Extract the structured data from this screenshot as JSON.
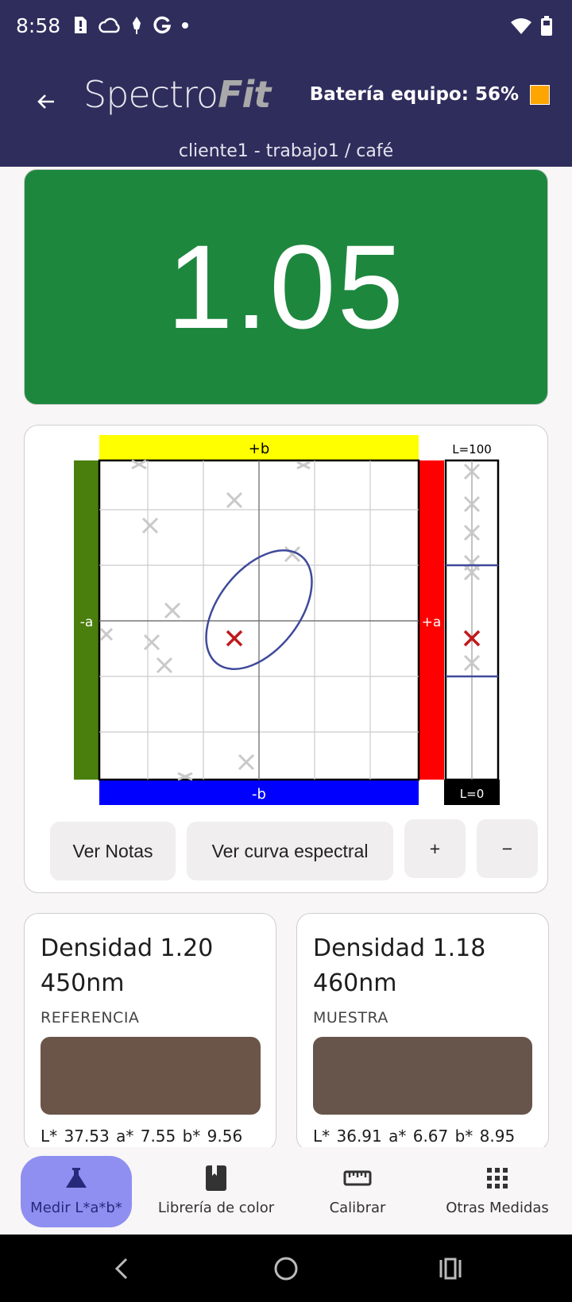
{
  "status_bar": {
    "time": "8:58"
  },
  "app_bar": {
    "logo_part1": "Spectro",
    "logo_part2": "Fit",
    "battery_text": "Batería equipo: 56%",
    "battery_color": "#ffa500",
    "subtitle": "cliente1 - trabajo1 / café"
  },
  "delta": {
    "value": "1.05",
    "color": "#1e873e"
  },
  "chart": {
    "top_label": "+b",
    "bottom_label": "-b",
    "left_label": "-a",
    "right_label": "+a",
    "l_top_label": "L=100",
    "l_bottom_label": "L=0",
    "colors": {
      "plus_b": "#ffff00",
      "minus_b": "#0000ff",
      "minus_a": "#4a7f0e",
      "plus_a": "#ff0000",
      "ellipse": "#3f4a9a",
      "sample_mark": "#c0191c"
    }
  },
  "chart_buttons": {
    "notes": "Ver Notas",
    "spectral": "Ver curva espectral",
    "zoom_in": "+",
    "zoom_out": "−"
  },
  "reference": {
    "title_line1": "Densidad 1.20",
    "title_line2": "450nm",
    "label": "REFERENCIA",
    "swatch_color": "#6b5548",
    "lab": "L* 37.53   a* 7.55   b* 9.56"
  },
  "sample": {
    "title_line1": "Densidad 1.18",
    "title_line2": "460nm",
    "label": "MUESTRA",
    "swatch_color": "#67554b",
    "lab": "L* 36.91   a* 6.67   b* 8.95"
  },
  "bottom_nav": [
    {
      "label": "Medir L*a*b*",
      "icon": "flask-icon",
      "active": true
    },
    {
      "label": "Librería de color",
      "icon": "book-icon",
      "active": false
    },
    {
      "label": "Calibrar",
      "icon": "ruler-icon",
      "active": false
    },
    {
      "label": "Otras Medidas",
      "icon": "grid-icon",
      "active": false
    }
  ]
}
